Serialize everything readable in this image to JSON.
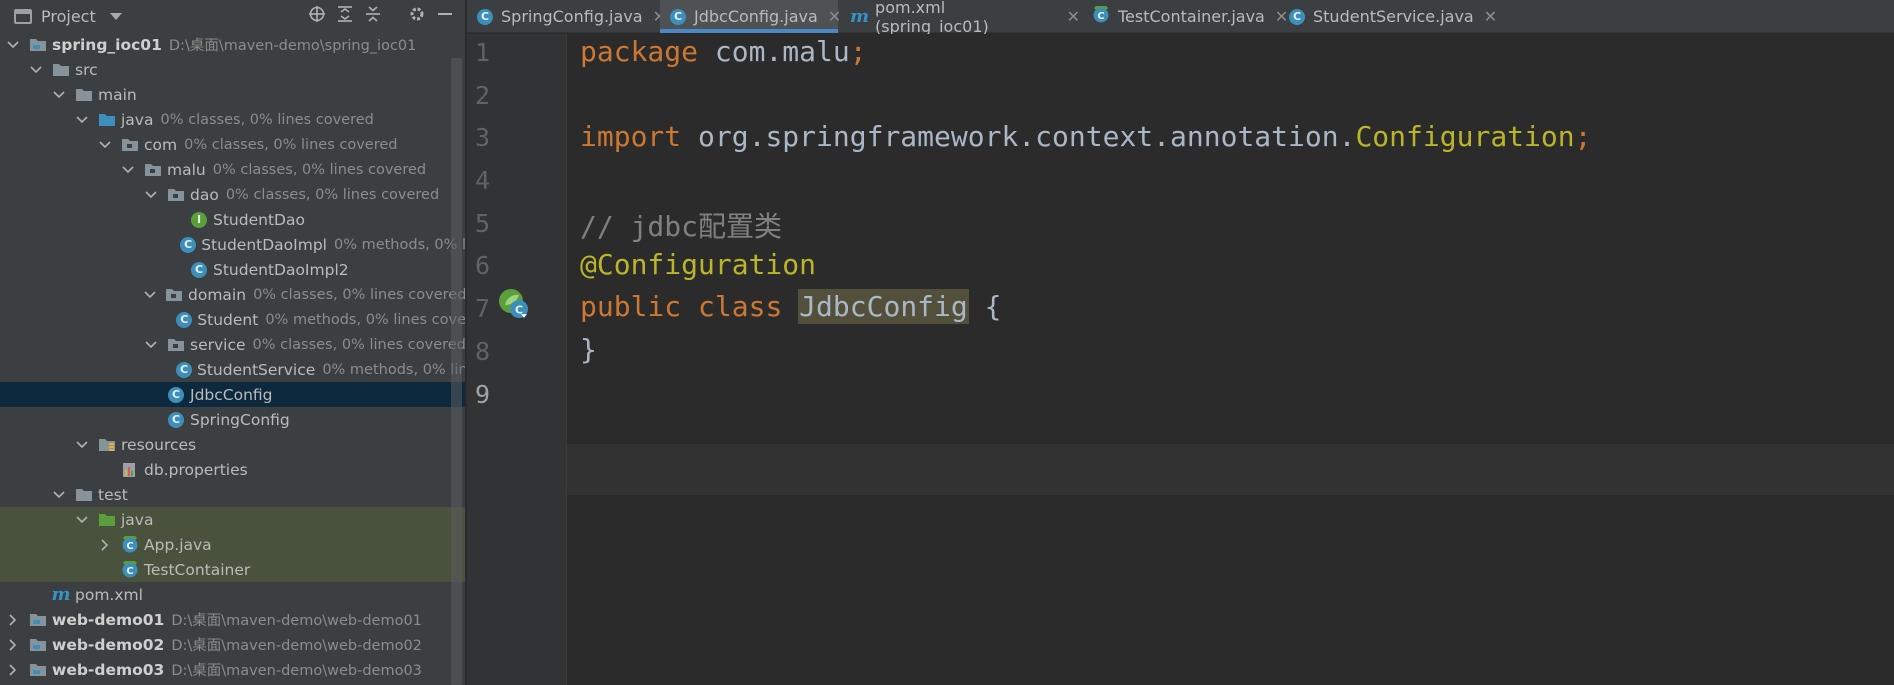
{
  "project_panel": {
    "title": "Project",
    "tree": [
      {
        "label": "spring_ioc01",
        "sub": "D:\\桌面\\maven-demo\\spring_ioc01",
        "icon": "module-folder-icon"
      },
      {
        "label": "src",
        "sub": "",
        "icon": "folder-icon"
      },
      {
        "label": "main",
        "sub": "",
        "icon": "folder-icon"
      },
      {
        "label": "java",
        "sub": "0% classes, 0% lines covered",
        "icon": "source-root-icon"
      },
      {
        "label": "com",
        "sub": "0% classes, 0% lines covered",
        "icon": "package-icon"
      },
      {
        "label": "malu",
        "sub": "0% classes, 0% lines covered",
        "icon": "package-icon"
      },
      {
        "label": "dao",
        "sub": "0% classes, 0% lines covered",
        "icon": "package-icon"
      },
      {
        "label": "StudentDao",
        "sub": "",
        "icon": "interface-icon"
      },
      {
        "label": "StudentDaoImpl",
        "sub": "0% methods, 0% l",
        "icon": "class-icon"
      },
      {
        "label": "StudentDaoImpl2",
        "sub": "",
        "icon": "class-icon"
      },
      {
        "label": "domain",
        "sub": "0% classes, 0% lines covered",
        "icon": "package-icon"
      },
      {
        "label": "Student",
        "sub": "0% methods, 0% lines cove",
        "icon": "class-icon"
      },
      {
        "label": "service",
        "sub": "0% classes, 0% lines covered",
        "icon": "package-icon"
      },
      {
        "label": "StudentService",
        "sub": "0% methods, 0% lin",
        "icon": "class-icon"
      },
      {
        "label": "JdbcConfig",
        "sub": "",
        "icon": "class-icon"
      },
      {
        "label": "SpringConfig",
        "sub": "",
        "icon": "class-icon"
      },
      {
        "label": "resources",
        "sub": "",
        "icon": "resources-folder-icon"
      },
      {
        "label": "db.properties",
        "sub": "",
        "icon": "properties-file-icon"
      },
      {
        "label": "test",
        "sub": "",
        "icon": "folder-icon"
      },
      {
        "label": "java",
        "sub": "",
        "icon": "test-root-icon"
      },
      {
        "label": "App.java",
        "sub": "",
        "icon": "test-class-icon"
      },
      {
        "label": "TestContainer",
        "sub": "",
        "icon": "test-class-icon"
      },
      {
        "label": "pom.xml",
        "sub": "",
        "icon": "maven-icon"
      },
      {
        "label": "web-demo01",
        "sub": "D:\\桌面\\maven-demo\\web-demo01",
        "icon": "module-folder-icon"
      },
      {
        "label": "web-demo02",
        "sub": "D:\\桌面\\maven-demo\\web-demo02",
        "icon": "module-folder-icon"
      },
      {
        "label": "web-demo03",
        "sub": "D:\\桌面\\maven-demo\\web-demo03",
        "icon": "module-folder-icon"
      }
    ]
  },
  "tabs": [
    {
      "label": "SpringConfig.java",
      "icon": "class-icon"
    },
    {
      "label": "JdbcConfig.java",
      "icon": "class-icon",
      "active": true
    },
    {
      "label": "pom.xml (spring_ioc01)",
      "icon": "maven-icon"
    },
    {
      "label": "TestContainer.java",
      "icon": "test-class-icon"
    },
    {
      "label": "StudentService.java",
      "icon": "class-icon"
    }
  ],
  "editor": {
    "line_numbers": [
      "1",
      "2",
      "3",
      "4",
      "5",
      "6",
      "7",
      "8",
      "9"
    ],
    "current_line": "9",
    "code": {
      "l1_kw": "package",
      "l1_rest": " com.malu",
      "l1_semi": ";",
      "l3_kw": "import",
      "l3_rest": " org.springframework.context.annotation.",
      "l3_cls": "Configuration",
      "l3_semi": ";",
      "l5_comment": "// jdbc配置类",
      "l6_ann": "@Configuration",
      "l7_kw1": "public",
      "l7_kw2": "class",
      "l7_name": "JdbcConfig",
      "l7_brace": "{",
      "l8_brace": "}"
    }
  },
  "colors": {
    "keyword": "#cc7832",
    "annotation": "#bbb529",
    "comment": "#808080",
    "identifier": "#a9b7c6",
    "class_icon": "#3d8fb9",
    "selection": "#0d293e",
    "tab_underline": "#4a88c7"
  }
}
